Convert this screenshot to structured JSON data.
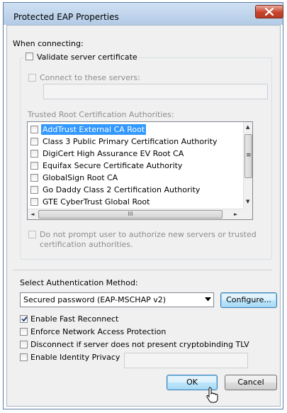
{
  "window": {
    "title": "Protected EAP Properties",
    "close_label": "close"
  },
  "connecting": {
    "heading": "When connecting:",
    "validate_cert": {
      "label": "Validate server certificate",
      "checked": false
    },
    "connect_servers": {
      "label": "Connect to these servers:",
      "checked": false,
      "enabled": false
    },
    "servers_value": "",
    "trusted_heading": "Trusted Root Certification Authorities:",
    "authorities": [
      {
        "label": "AddTrust External CA Root",
        "checked": false,
        "selected": true
      },
      {
        "label": "Class 3 Public Primary Certification Authority",
        "checked": false,
        "selected": false
      },
      {
        "label": "DigiCert High Assurance EV Root CA",
        "checked": false,
        "selected": false
      },
      {
        "label": "Equifax Secure Certificate Authority",
        "checked": false,
        "selected": false
      },
      {
        "label": "GlobalSign Root CA",
        "checked": false,
        "selected": false
      },
      {
        "label": "Go Daddy Class 2 Certification Authority",
        "checked": false,
        "selected": false
      },
      {
        "label": "GTE CyberTrust Global Root",
        "checked": false,
        "selected": false
      }
    ],
    "scroll": {
      "up": "▲",
      "down": "▼",
      "left": "◄",
      "right": "►",
      "grip": "III",
      "vgrip": "≡"
    },
    "no_prompt": {
      "line1": "Do not prompt user to authorize new servers or trusted",
      "line2": "certification authorities.",
      "checked": false,
      "enabled": false
    }
  },
  "auth": {
    "heading": "Select Authentication Method:",
    "method": "Secured password (EAP-MSCHAP v2)",
    "configure_label": "Configure..."
  },
  "options": [
    {
      "label": "Enable Fast Reconnect",
      "checked": true
    },
    {
      "label": "Enforce Network Access Protection",
      "checked": false
    },
    {
      "label": "Disconnect if server does not present cryptobinding TLV",
      "checked": false
    },
    {
      "label": "Enable Identity Privacy",
      "checked": false
    }
  ],
  "identity_value": "",
  "buttons": {
    "ok": "OK",
    "cancel": "Cancel"
  },
  "colors": {
    "selection": "#3399ff",
    "close": "#c7442e",
    "focus_border": "#3c7fb1"
  }
}
